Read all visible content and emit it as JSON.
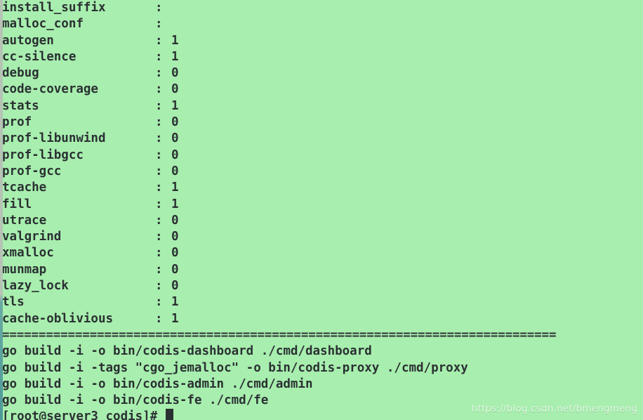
{
  "terminal": {
    "background_color": "#a8efaf",
    "text_color": "#2b3133",
    "cursor_color": "#2b3133",
    "config_rows": [
      {
        "key": "install_suffix",
        "separator": ":",
        "value": ""
      },
      {
        "key": "malloc_conf",
        "separator": ":",
        "value": ""
      },
      {
        "key": "autogen",
        "separator": ":",
        "value": "1"
      },
      {
        "key": "cc-silence",
        "separator": ":",
        "value": "1"
      },
      {
        "key": "debug",
        "separator": ":",
        "value": "0"
      },
      {
        "key": "code-coverage",
        "separator": ":",
        "value": "0"
      },
      {
        "key": "stats",
        "separator": ":",
        "value": "1"
      },
      {
        "key": "prof",
        "separator": ":",
        "value": "0"
      },
      {
        "key": "prof-libunwind",
        "separator": ":",
        "value": "0"
      },
      {
        "key": "prof-libgcc",
        "separator": ":",
        "value": "0"
      },
      {
        "key": "prof-gcc",
        "separator": ":",
        "value": "0"
      },
      {
        "key": "tcache",
        "separator": ":",
        "value": "1"
      },
      {
        "key": "fill",
        "separator": ":",
        "value": "1"
      },
      {
        "key": "utrace",
        "separator": ":",
        "value": "0"
      },
      {
        "key": "valgrind",
        "separator": ":",
        "value": "0"
      },
      {
        "key": "xmalloc",
        "separator": ":",
        "value": "0"
      },
      {
        "key": "munmap",
        "separator": ":",
        "value": "0"
      },
      {
        "key": "lazy_lock",
        "separator": ":",
        "value": "0"
      },
      {
        "key": "tls",
        "separator": ":",
        "value": "1"
      },
      {
        "key": "cache-oblivious",
        "separator": ":",
        "value": "1"
      }
    ],
    "separator_rule": "============================================================================",
    "build_lines": [
      "go build -i -o bin/codis-dashboard ./cmd/dashboard",
      "go build -i -tags \"cgo_jemalloc\" -o bin/codis-proxy ./cmd/proxy",
      "go build -i -o bin/codis-admin ./cmd/admin",
      "go build -i -o bin/codis-fe ./cmd/fe"
    ],
    "prompt": "[root@server3 codis]# ",
    "watermark": "https://blog.csdn.net/bmengmeng"
  }
}
